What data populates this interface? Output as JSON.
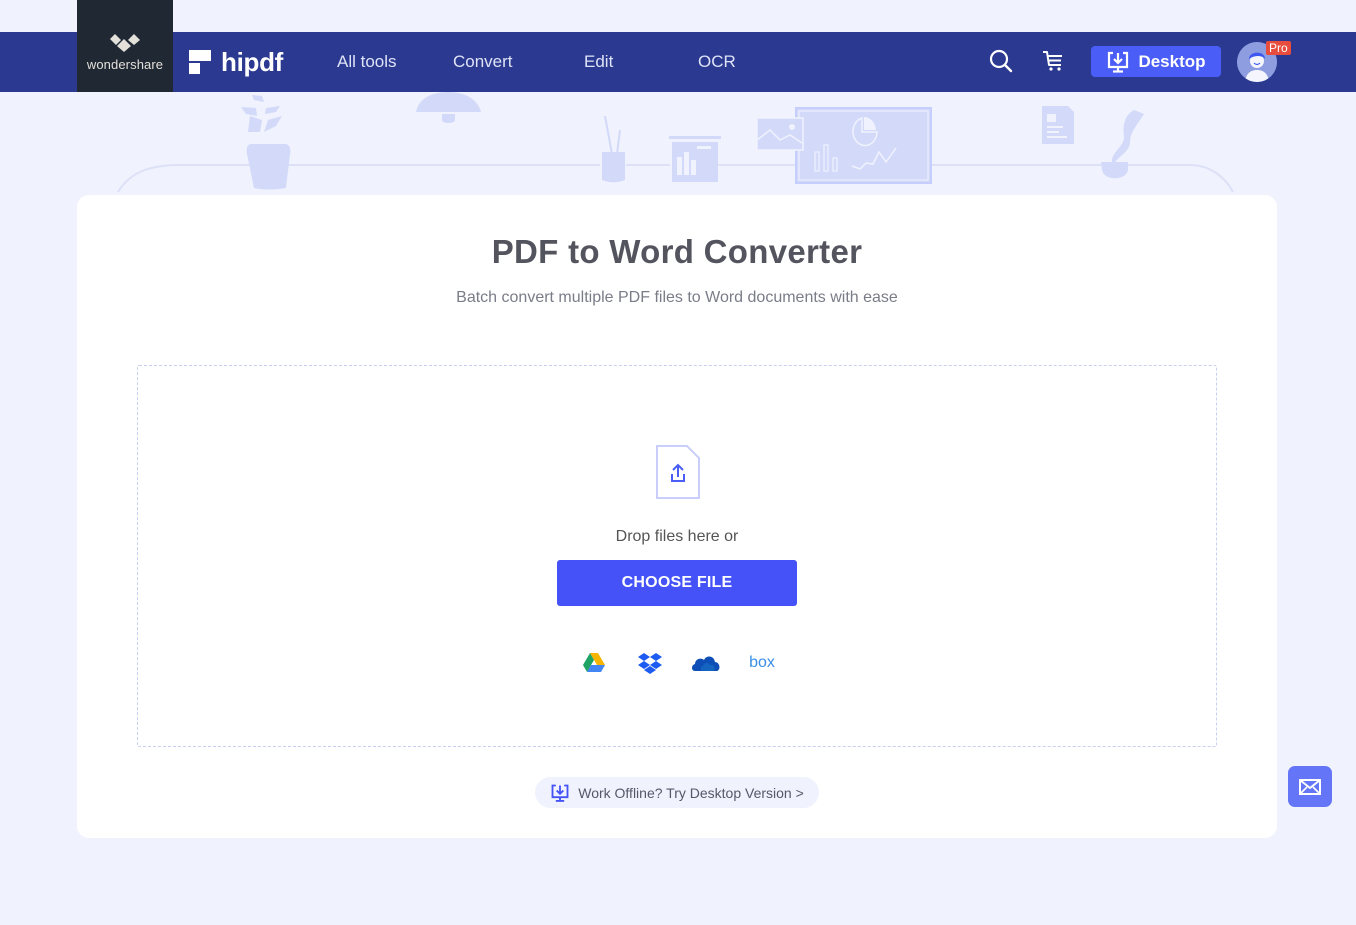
{
  "brand": {
    "parent_name": "wondershare",
    "product_name": "hipdf"
  },
  "nav": {
    "items": [
      {
        "label": "All tools"
      },
      {
        "label": "Convert"
      },
      {
        "label": "Edit"
      },
      {
        "label": "OCR"
      }
    ],
    "search_icon": "search-icon",
    "cart_icon": "cart-icon",
    "desktop_button": "Desktop",
    "pro_badge": "Pro"
  },
  "main": {
    "title": "PDF to Word Converter",
    "subtitle": "Batch convert multiple PDF files to Word documents with ease",
    "drop_text": "Drop files here or",
    "choose_button": "CHOOSE FILE",
    "cloud_sources": [
      {
        "name": "Google Drive",
        "icon": "google-drive-icon"
      },
      {
        "name": "Dropbox",
        "icon": "dropbox-icon"
      },
      {
        "name": "OneDrive",
        "icon": "onedrive-icon"
      },
      {
        "name": "Box",
        "icon": "box-icon",
        "label": "box"
      }
    ],
    "offline_link": "Work Offline? Try Desktop Version >"
  },
  "colors": {
    "nav_bg": "#2b3990",
    "accent": "#4452f7",
    "page_bg": "#f0f2fd"
  }
}
